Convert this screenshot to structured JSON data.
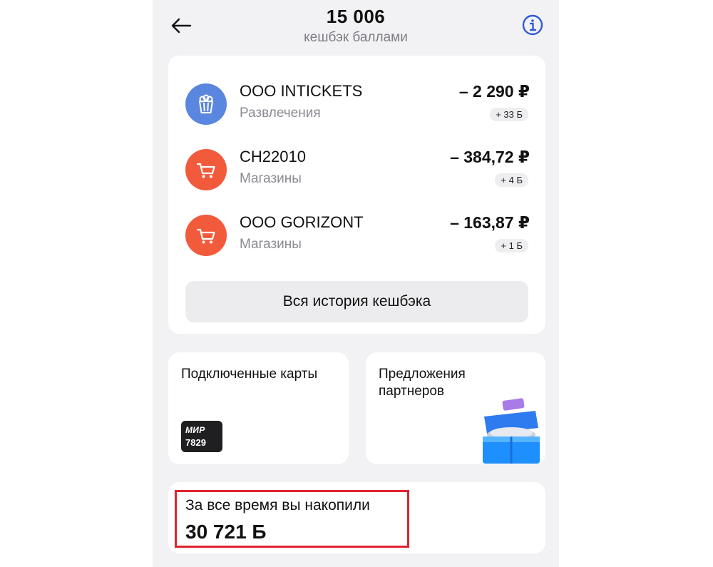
{
  "header": {
    "balance": "15 006",
    "subtitle": "кешбэк баллами"
  },
  "transactions": [
    {
      "name": "ООО INTICKETS",
      "category": "Развлечения",
      "amount": "– 2 290 ₽",
      "bonus": "+ 33 Б",
      "icon": "popcorn-icon",
      "color": "#5b86e0"
    },
    {
      "name": "CH22010",
      "category": "Магазины",
      "amount": "– 384,72 ₽",
      "bonus": "+ 4 Б",
      "icon": "cart-icon",
      "color": "#f25a3c"
    },
    {
      "name": "ООО GORIZONT",
      "category": "Магазины",
      "amount": "– 163,87 ₽",
      "bonus": "+ 1 Б",
      "icon": "cart-icon",
      "color": "#f25a3c"
    }
  ],
  "history_button": "Вся история кешбэка",
  "tiles": {
    "cards_title": "Подключенные карты",
    "card": {
      "brand": "МИР",
      "number": "7829"
    },
    "partners_title": "Предложения партнеров"
  },
  "total": {
    "label": "За все время вы накопили",
    "value": "30 721 Б"
  },
  "colors": {
    "accent_blue": "#2f5bd3",
    "highlight_red": "#e0232e"
  }
}
